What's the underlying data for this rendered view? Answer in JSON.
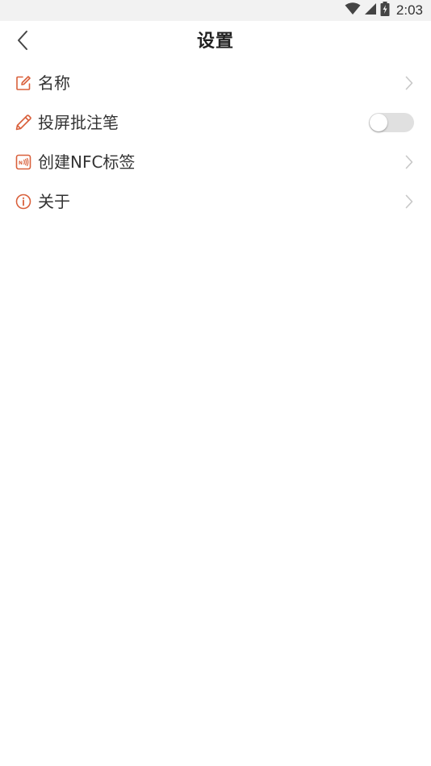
{
  "status_bar": {
    "time": "2:03",
    "icons": [
      "wifi-icon",
      "cellular-signal-icon",
      "battery-charging-icon"
    ]
  },
  "app_bar": {
    "title": "设置",
    "back_icon": "chevron-left-icon"
  },
  "settings": {
    "items": [
      {
        "label": "名称",
        "icon": "edit-icon",
        "control": "chevron"
      },
      {
        "label": "投屏批注笔",
        "icon": "pencil-icon",
        "control": "toggle",
        "toggle_on": false
      },
      {
        "label": "创建NFC标签",
        "icon": "nfc-icon",
        "control": "chevron"
      },
      {
        "label": "关于",
        "icon": "info-icon",
        "control": "chevron"
      }
    ]
  },
  "colors": {
    "accent": "#d9603b",
    "status_bar_bg": "#f2f2f2",
    "toggle_off_bg": "#e0e0e0",
    "chevron": "#c8c8c8"
  }
}
